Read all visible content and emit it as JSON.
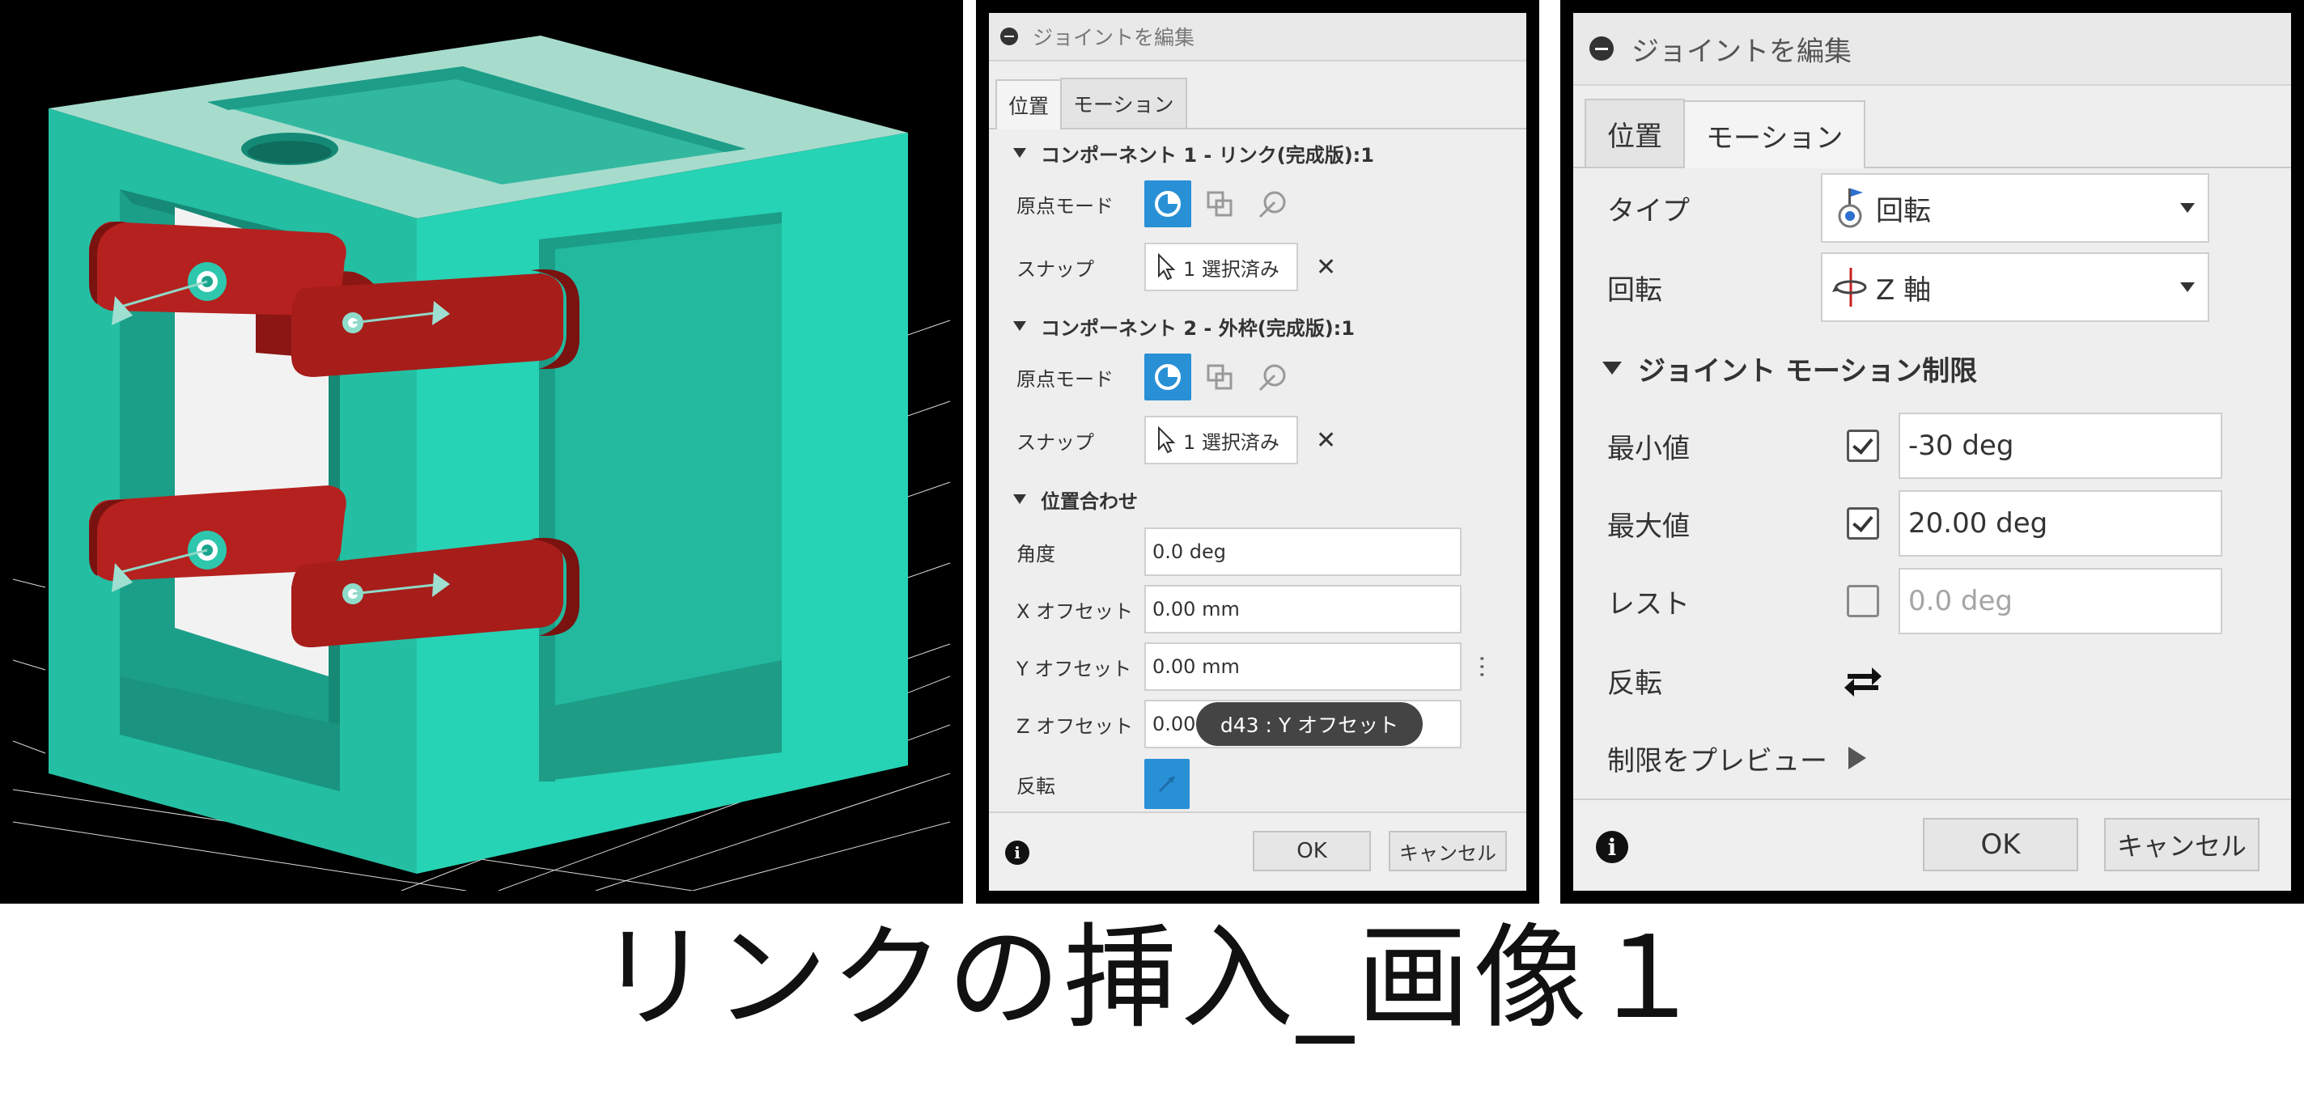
{
  "mid_dialog": {
    "title": "ジョイントを編集",
    "tabs": [
      {
        "label": "位置"
      },
      {
        "label": "モーション"
      }
    ],
    "component1": {
      "header": "コンポーネント 1 - リンク(完成版):1",
      "origin_mode_label": "原点モード",
      "snap_label": "スナップ",
      "snap_value": "1 選択済み"
    },
    "component2": {
      "header": "コンポーネント 2 - 外枠(完成版):1",
      "origin_mode_label": "原点モード",
      "snap_label": "スナップ",
      "snap_value": "1 選択済み"
    },
    "alignment": {
      "header": "位置合わせ",
      "angle_label": "角度",
      "angle_value": "0.0 deg",
      "x_label": "X オフセット",
      "x_value": "0.00 mm",
      "y_label": "Y オフセット",
      "y_value": "0.00 mm",
      "z_label": "Z オフセット",
      "z_value": "0.00",
      "flip_label": "反転"
    },
    "tooltip": "d43 : Y オフセット",
    "ok_label": "OK",
    "cancel_label": "キャンセル",
    "accent_color": "#2990d6"
  },
  "right_dialog": {
    "title": "ジョイントを編集",
    "tabs": [
      {
        "label": "位置"
      },
      {
        "label": "モーション"
      }
    ],
    "type_label": "タイプ",
    "type_value": "回転",
    "rotation_label": "回転",
    "rotation_value": "Z 軸",
    "limits_header": "ジョイント モーション制限",
    "min_label": "最小値",
    "min_value": "-30 deg",
    "min_checked": true,
    "max_label": "最大値",
    "max_value": "20.00 deg",
    "max_checked": true,
    "rest_label": "レスト",
    "rest_value": "0.0 deg",
    "rest_checked": false,
    "flip_label": "反転",
    "preview_label": "制限をプレビュー",
    "ok_label": "OK",
    "cancel_label": "キャンセル"
  },
  "viewport": {
    "frame_color": "#22c9aa",
    "link_color": "#b5211e"
  },
  "caption": "リンクの挿入_画像１"
}
